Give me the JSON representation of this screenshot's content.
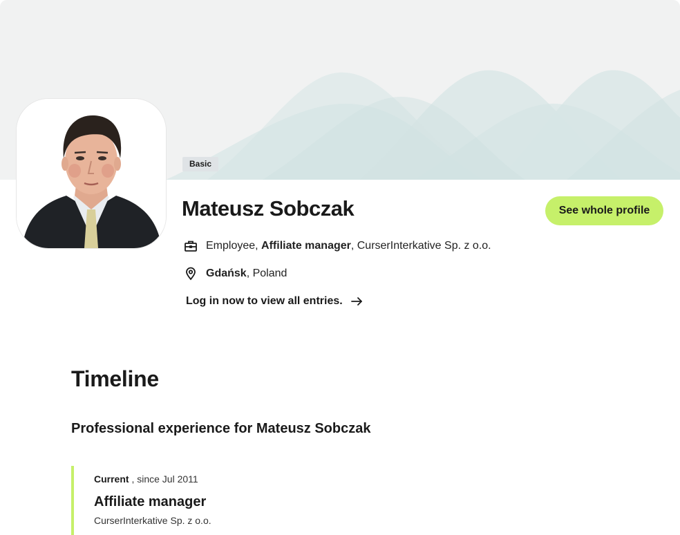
{
  "profile": {
    "badge": "Basic",
    "name": "Mateusz Sobczak",
    "cta_label": "See whole profile",
    "job": {
      "type": "Employee",
      "sep1": ", ",
      "title": "Affiliate manager",
      "sep2": ", ",
      "company": "CurserInterkative Sp. z o.o."
    },
    "location": {
      "city": "Gdańsk",
      "sep": ", ",
      "country": "Poland"
    },
    "login_prompt": "Log in now to view all entries."
  },
  "timeline": {
    "title": "Timeline",
    "subtitle": "Professional experience for Mateusz Sobczak",
    "entries": [
      {
        "status": "Current",
        "since": " , since Jul 2011",
        "role": "Affiliate manager",
        "company": "CurserInterkative Sp. z o.o."
      }
    ]
  },
  "icons": {
    "job": "briefcase-icon",
    "location": "map-pin-icon",
    "login": "arrow-right-icon"
  },
  "colors": {
    "accent": "#c6f06a",
    "banner_bg": "#f1f2f2",
    "wave": "#d6e6e6",
    "badge_bg": "#dfe3e6"
  }
}
